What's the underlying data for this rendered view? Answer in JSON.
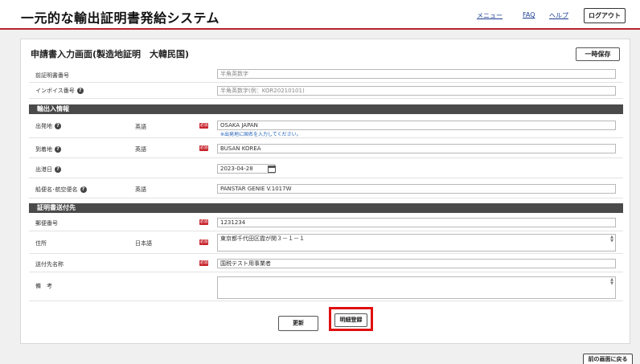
{
  "header": {
    "app_title": "一元的な輸出証明書発給システム",
    "nav_menu": "メニュー",
    "nav_faq": "FAQ",
    "nav_help": "ヘルプ",
    "logout": "ログアウト"
  },
  "form": {
    "heading": "申請書入力画面(製造地証明　大韓民国)",
    "save_temp": "一時保存",
    "required_badge": "必須",
    "help_glyph": "?",
    "previous_cert": {
      "label": "前証明書番号",
      "placeholder": "半角英数字"
    },
    "invoice": {
      "label": "インボイス番号",
      "placeholder": "半角英数字(例：KOR20210101)"
    },
    "section_trade": "輸出入情報",
    "departure": {
      "label": "出発地",
      "lang": "英語",
      "value": "OSAKA JAPAN",
      "hint": "※出発地に国名を入力してください。"
    },
    "arrival": {
      "label": "到着地",
      "lang": "英語",
      "value": "BUSAN KOREA"
    },
    "ship_date": {
      "label": "出港日",
      "value": "2023-04-28"
    },
    "vessel": {
      "label": "船便名･航空便名",
      "lang": "英語",
      "value": "PANSTAR GENIE V.1017W"
    },
    "section_recipient": "証明書送付先",
    "postal": {
      "label": "郵便番号",
      "value": "1231234"
    },
    "address": {
      "label": "住所",
      "lang": "日本語",
      "value": "東京都千代田区霞が関３－１－１"
    },
    "recipient_name": {
      "label": "送付先名称",
      "value": "国税テスト用事業者"
    },
    "remarks": {
      "label": "備　考",
      "value": ""
    },
    "update_button": "更新",
    "detail_button": "明細登録",
    "back_button": "前の画面に戻る"
  },
  "colors": {
    "accent_red": "#b8232b",
    "required_red": "#c8242c",
    "highlight_red": "#e01010",
    "section_bg": "#4a4a4a"
  }
}
